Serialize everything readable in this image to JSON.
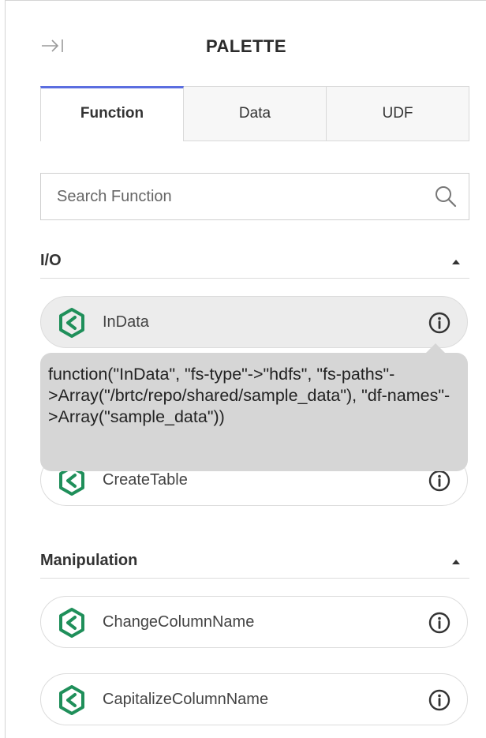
{
  "palette": {
    "title": "PALETTE",
    "collapse_icon": "collapse-right-icon"
  },
  "tabs": [
    {
      "label": "Function",
      "active": true
    },
    {
      "label": "Data",
      "active": false
    },
    {
      "label": "UDF",
      "active": false
    }
  ],
  "search": {
    "placeholder": "Search Function",
    "icon": "search-icon"
  },
  "sections": [
    {
      "label": "I/O",
      "expanded": true,
      "items": [
        {
          "label": "InData",
          "icon": "gear-icon"
        },
        {
          "label": "CreateTable",
          "icon": "gear-icon"
        }
      ]
    },
    {
      "label": "Manipulation",
      "expanded": true,
      "items": [
        {
          "label": "ChangeColumnName",
          "icon": "gear-icon"
        },
        {
          "label": "CapitalizeColumnName",
          "icon": "gear-icon"
        }
      ]
    }
  ],
  "tooltip": {
    "text": "function(\"InData\", \"fs-type\"->\"hdfs\", \"fs-paths\"->Array(\"/brtc/repo/shared/sample_data\"), \"df-names\"->Array(\"sample_data\"))"
  },
  "colors": {
    "accent": "#5b6ee0",
    "icon_green": "#1f8f5a",
    "tooltip_bg": "#d6d6d6"
  }
}
